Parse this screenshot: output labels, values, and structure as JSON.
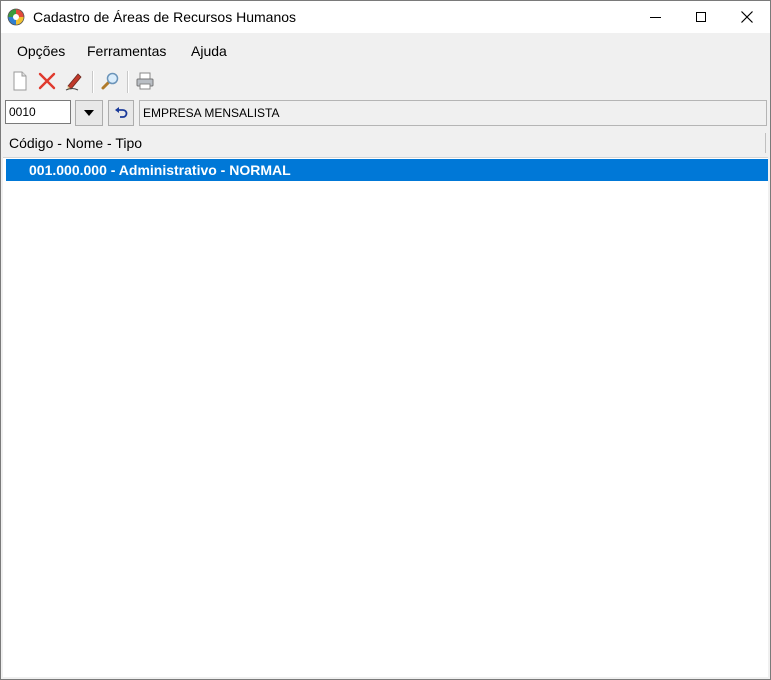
{
  "window": {
    "title": "Cadastro de Áreas de Recursos Humanos",
    "icon": "app-globe-icon"
  },
  "menu": {
    "items": [
      "Opções",
      "Ferramentas",
      "Ajuda"
    ]
  },
  "toolbar": {
    "buttons": [
      "new-document-icon",
      "delete-icon",
      "edit-pencil-icon",
      "search-magnifier-icon",
      "print-icon"
    ]
  },
  "company": {
    "code": "0010",
    "name": "EMPRESA MENSALISTA"
  },
  "list": {
    "header": "Código - Nome - Tipo",
    "rows": [
      "001.000.000 - Administrativo - NORMAL"
    ],
    "selected_color": "#0078d7"
  }
}
